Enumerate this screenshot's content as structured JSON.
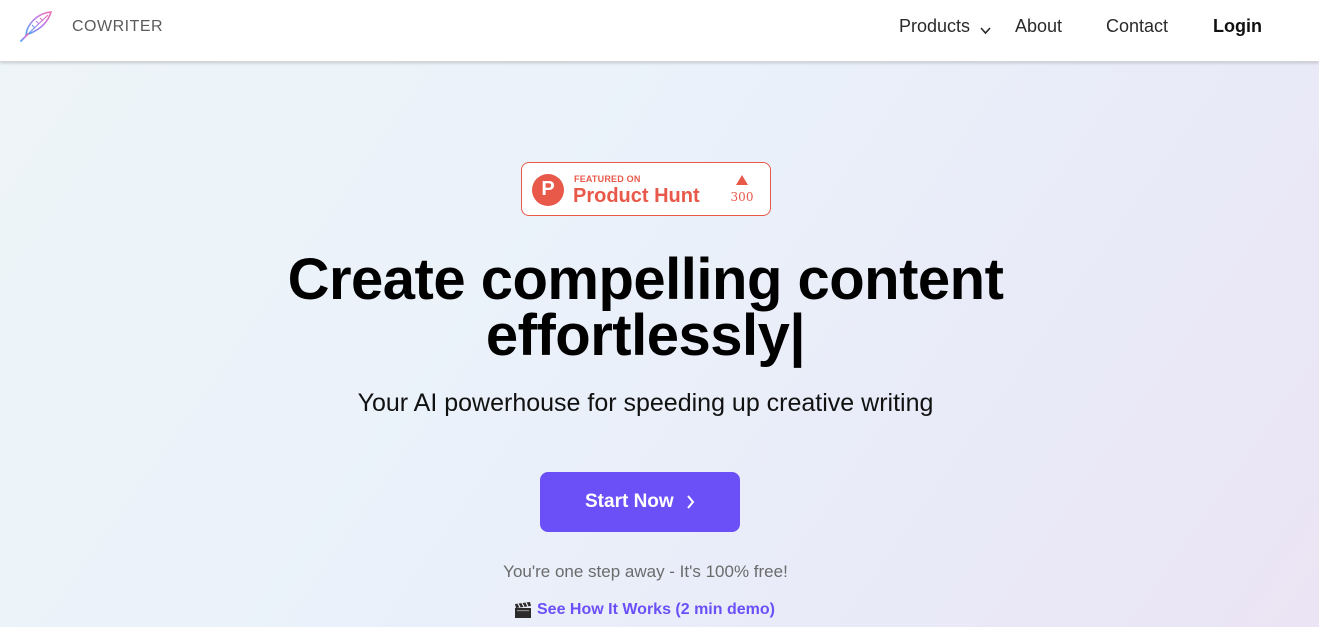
{
  "header": {
    "brand": "COWRITER",
    "nav": {
      "products": "Products",
      "about": "About",
      "contact": "Contact",
      "login": "Login"
    }
  },
  "product_hunt": {
    "featured_on": "FEATURED ON",
    "name": "Product Hunt",
    "logo_letter": "P",
    "upvotes": "300"
  },
  "hero": {
    "headline_line1": "Create compelling content",
    "headline_line2": "effortlessly|",
    "subheadline": "Your AI powerhouse for speeding up creative writing",
    "cta_label": "Start Now",
    "note": "You're one step away - It's 100% free!",
    "demo_link": "See How It Works (2 min demo)"
  },
  "icons": {
    "logo": "feather-quill-icon",
    "products_dropdown": "chevron-down-icon",
    "product_hunt_upvote": "triangle-up-icon",
    "cta": "chevron-right-icon",
    "demo": "clapperboard-icon"
  },
  "colors": {
    "accent": "#6b4ff7",
    "product_hunt": "#e8594a",
    "text": "#000000",
    "muted": "#6b6b6b"
  }
}
